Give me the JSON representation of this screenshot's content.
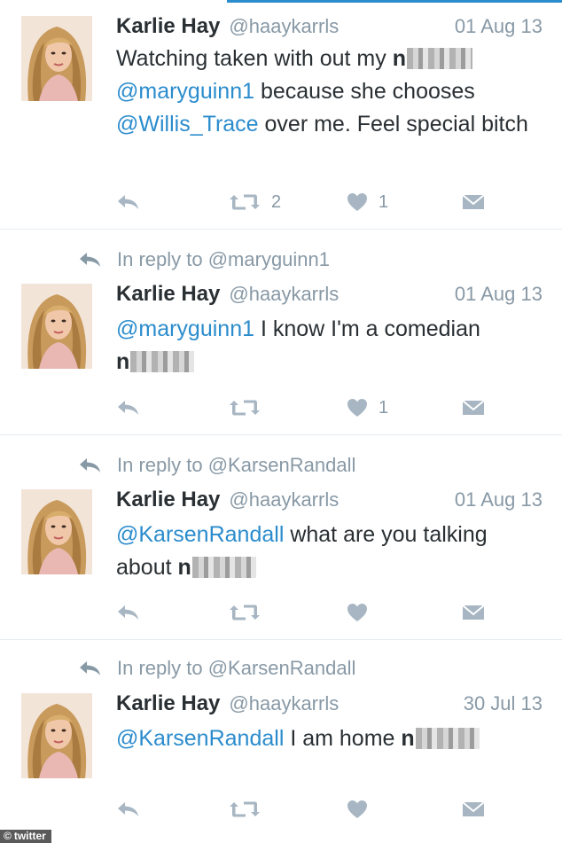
{
  "tweets": [
    {
      "reply_to": "",
      "name": "Karlie Hay",
      "handle": "@haaykarrls",
      "date": "01 Aug 13",
      "line1_pre": "Watching taken with out my ",
      "line1_censored": "n",
      "mention1": "@maryguinn1",
      "text_mid": " because she chooses",
      "mention2": "@Willis_Trace",
      "text_end": " over me. Feel special bitch",
      "retweets": "2",
      "likes": "1"
    },
    {
      "reply_to": "In reply to @maryguinn1",
      "name": "Karlie Hay",
      "handle": "@haaykarrls",
      "date": "01 Aug 13",
      "mention": "@maryguinn1",
      "text": " I know I'm a comedian",
      "censored": "n",
      "retweets": "",
      "likes": "1"
    },
    {
      "reply_to": "In reply to @KarsenRandall",
      "name": "Karlie Hay",
      "handle": "@haaykarrls",
      "date": "01 Aug 13",
      "mention": "@KarsenRandall",
      "text": " what are you talking about ",
      "censored": "n",
      "retweets": "",
      "likes": ""
    },
    {
      "reply_to": "In reply to @KarsenRandall",
      "name": "Karlie Hay",
      "handle": "@haaykarrls",
      "date": "30 Jul 13",
      "mention": "@KarsenRandall",
      "text": " I am home ",
      "censored": "n",
      "retweets": "",
      "likes": ""
    }
  ],
  "icons": {
    "reply": "reply-arrow-icon",
    "retweet": "retweet-icon",
    "like": "heart-icon",
    "dm": "envelope-icon",
    "reply_context": "reply-arrow-icon"
  },
  "colors": {
    "link": "#2b8ccd",
    "muted": "#8899a6",
    "icon": "#a7b6c2",
    "text": "#292f33",
    "divider": "#e6ecf0"
  },
  "watermark": "twitter",
  "watermark_symbol": "©"
}
